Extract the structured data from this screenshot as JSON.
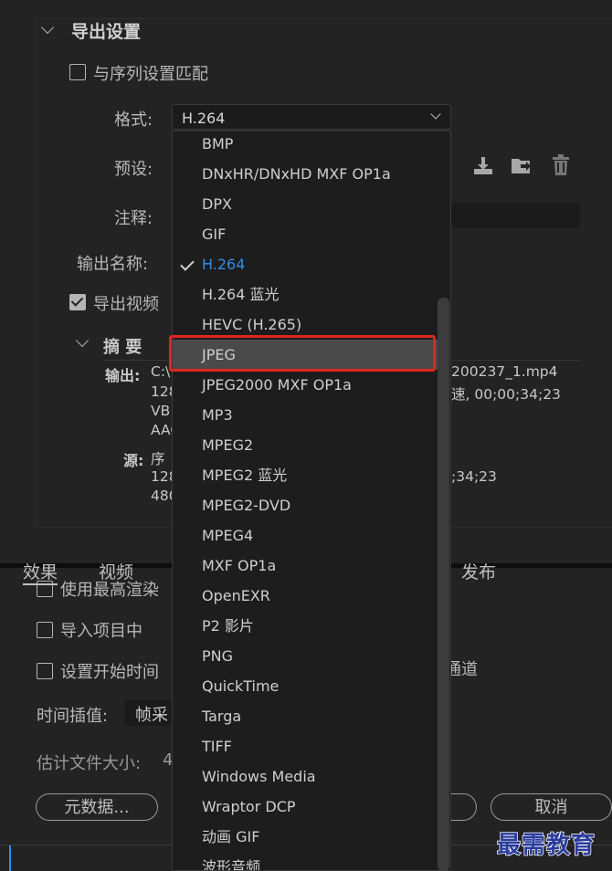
{
  "export_settings": {
    "title": "导出设置",
    "match_sequence_label": "与序列设置匹配",
    "format_label": "格式:",
    "format_value": "H.264",
    "preset_label": "预设:",
    "comment_label": "注释:",
    "output_name_label": "输出名称:",
    "export_video_label": "导出视频",
    "summary_title": "摘 要",
    "output_label": "输出:",
    "output_lines": [
      "C:\\",
      "128",
      "VB",
      "AAC"
    ],
    "output_right_lines": [
      "200237_1.mp4",
      "速, 00;00;34;23"
    ],
    "source_label": "源:",
    "source_lines": [
      "序",
      "128",
      "480"
    ],
    "source_right_lines": [
      ";34;23"
    ]
  },
  "tabs": [
    {
      "label": "效果",
      "active": true
    },
    {
      "label": "视频",
      "active": false
    },
    {
      "label": "发布",
      "active": false
    }
  ],
  "options": {
    "max_render_label": "使用最高渲染",
    "import_project_label": "导入项目中",
    "set_start_time_label": "设置开始时间",
    "channel_fragment": "通道",
    "time_interp_label": "时间插值:",
    "time_interp_value": "帧采",
    "estimated_size_label": "估计文件大小:",
    "estimated_size_value": "4"
  },
  "buttons": {
    "metadata_label": "元数据...",
    "cancel_label": "取消"
  },
  "dropdown": {
    "items": [
      {
        "label": "BMP"
      },
      {
        "label": "DNxHR/DNxHD MXF OP1a"
      },
      {
        "label": "DPX"
      },
      {
        "label": "GIF"
      },
      {
        "label": "H.264",
        "selected": true
      },
      {
        "label": "H.264 蓝光"
      },
      {
        "label": "HEVC (H.265)"
      },
      {
        "label": "JPEG",
        "hover": true
      },
      {
        "label": "JPEG2000 MXF OP1a"
      },
      {
        "label": "MP3"
      },
      {
        "label": "MPEG2"
      },
      {
        "label": "MPEG2 蓝光"
      },
      {
        "label": "MPEG2-DVD"
      },
      {
        "label": "MPEG4"
      },
      {
        "label": "MXF OP1a"
      },
      {
        "label": "OpenEXR"
      },
      {
        "label": "P2 影片"
      },
      {
        "label": "PNG"
      },
      {
        "label": "QuickTime"
      },
      {
        "label": "Targa"
      },
      {
        "label": "TIFF"
      },
      {
        "label": "Windows Media"
      },
      {
        "label": "Wraptor DCP"
      },
      {
        "label": "动画 GIF"
      },
      {
        "label": "波形音频"
      }
    ]
  },
  "watermark": "最需教育",
  "colors": {
    "background": "#232323",
    "selected_item": "#2f8fe8",
    "highlight_box": "#e1251b"
  }
}
